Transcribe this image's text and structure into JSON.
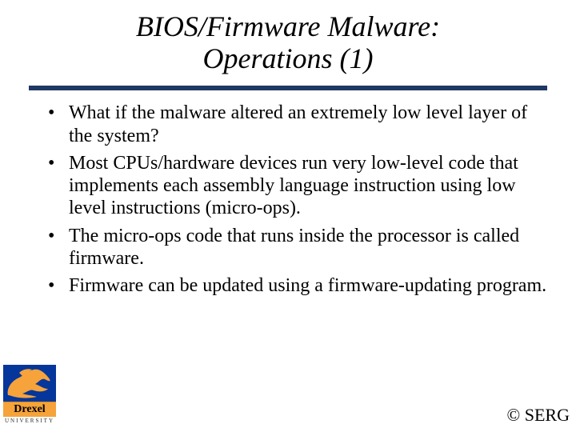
{
  "title_line1": "BIOS/Firmware Malware:",
  "title_line2": "Operations (1)",
  "bullets": [
    "What if the malware altered an extremely low level layer of the system?",
    "Most CPUs/hardware devices run very low-level code that implements each assembly language instruction using low level instructions (micro-ops).",
    "The micro-ops code that runs inside the processor is called firmware.",
    "Firmware can be updated using a firmware-updating program."
  ],
  "logo": {
    "name": "Drexel",
    "sub": "UNIVERSITY"
  },
  "copyright": "© SERG"
}
